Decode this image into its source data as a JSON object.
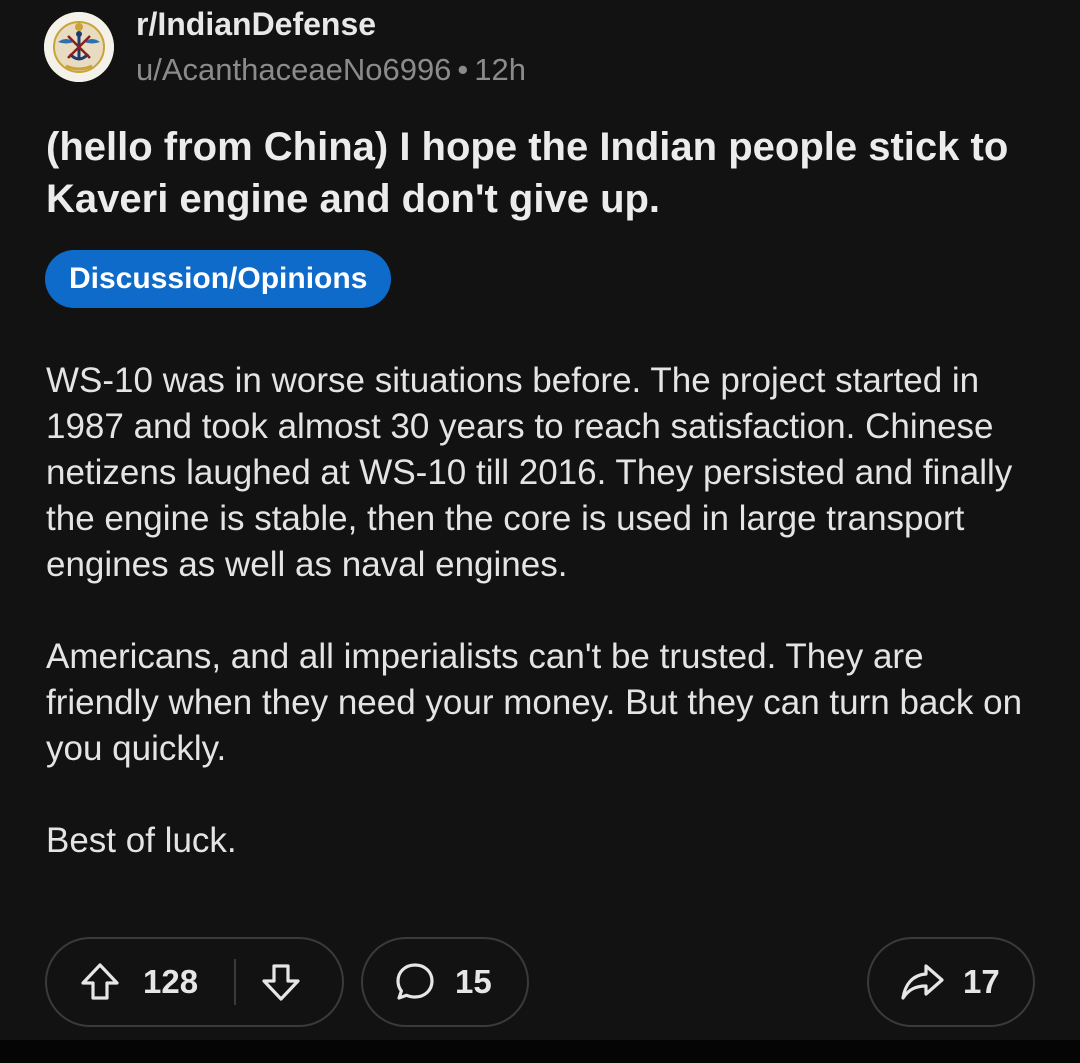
{
  "header": {
    "subreddit": "r/IndianDefense",
    "author": "u/AcanthaceaeNo6996",
    "separator": "•",
    "time": "12h",
    "avatar_icon": "tri-services-emblem-icon"
  },
  "post": {
    "title": "(hello from China) I hope the Indian people stick to Kaveri engine and don't give up.",
    "flair": "Discussion/Opinions",
    "flair_color": "#0e6bc9",
    "paragraphs": [
      "WS-10 was in worse situations before. The project started in 1987 and took almost 30 years to reach satisfaction. Chinese netizens laughed at WS-10 till 2016. They persisted and finally the engine is stable, then the core is used in large transport engines as well as naval engines.",
      "Americans, and all imperialists can't be trusted. They are friendly when they need your money. But they can turn back on you quickly.",
      "Best of luck."
    ]
  },
  "actions": {
    "upvotes": "128",
    "comments": "15",
    "shares": "17",
    "upvote_icon": "upvote-arrow-icon",
    "downvote_icon": "downvote-arrow-icon",
    "comment_icon": "comment-bubble-icon",
    "share_icon": "share-arrow-icon"
  },
  "colors": {
    "background": "#121212",
    "text": "#e4e4e4",
    "muted_text": "#8b8b8b",
    "pill_border": "#3a3a3a"
  }
}
